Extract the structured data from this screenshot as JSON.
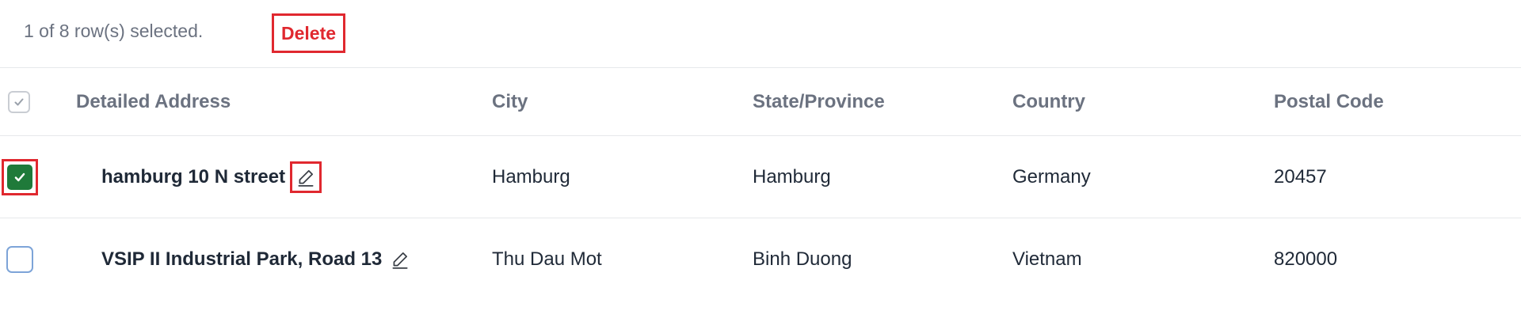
{
  "selection": {
    "summary": "1 of 8 row(s) selected.",
    "delete_label": "Delete"
  },
  "table": {
    "columns": [
      "Detailed Address",
      "City",
      "State/Province",
      "Country",
      "Postal Code"
    ],
    "rows": [
      {
        "selected": true,
        "address": "hamburg 10 N street",
        "city": "Hamburg",
        "state": "Hamburg",
        "country": "Germany",
        "postal_code": "20457"
      },
      {
        "selected": false,
        "address": "VSIP II Industrial Park, Road 13",
        "city": "Thu Dau Mot",
        "state": "Binh Duong",
        "country": "Vietnam",
        "postal_code": "820000"
      }
    ]
  },
  "colors": {
    "accent_red": "#e0282f",
    "checkbox_green": "#1f7a3a"
  },
  "icons": {
    "header_checkbox": "check-icon",
    "row_checkbox": "check-icon",
    "edit": "pencil-icon"
  }
}
